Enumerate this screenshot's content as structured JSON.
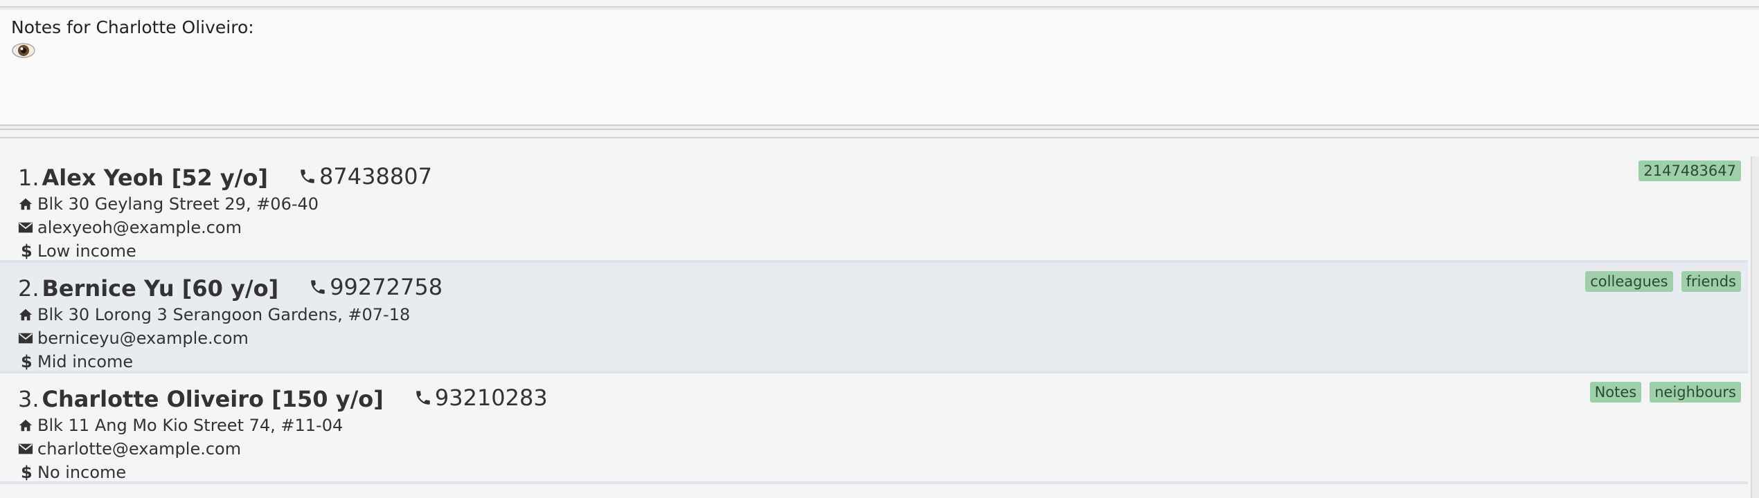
{
  "notes": {
    "title": "Notes for Charlotte Oliveiro:",
    "icon": "eye-icon"
  },
  "persons": [
    {
      "index": "1.",
      "name": "Alex Yeoh [52 y/o]",
      "phone": "87438807",
      "address": "Blk 30 Geylang Street 29, #06-40",
      "email": "alexyeoh@example.com",
      "income": "Low income",
      "tags": [
        "2147483647"
      ]
    },
    {
      "index": "2.",
      "name": "Bernice Yu [60 y/o]",
      "phone": "99272758",
      "address": "Blk 30 Lorong 3 Serangoon Gardens, #07-18",
      "email": "berniceyu@example.com",
      "income": "Mid income",
      "tags": [
        "colleagues",
        "friends"
      ]
    },
    {
      "index": "3.",
      "name": "Charlotte Oliveiro [150 y/o]",
      "phone": "93210283",
      "address": "Blk 11 Ang Mo Kio Street 74, #11-04",
      "email": "charlotte@example.com",
      "income": "No income",
      "tags": [
        "Notes",
        "neighbours"
      ]
    }
  ],
  "colors": {
    "tag_background": "#9fcfaa",
    "card_odd": "#f5f5f5",
    "card_even": "#e8ecf0"
  }
}
